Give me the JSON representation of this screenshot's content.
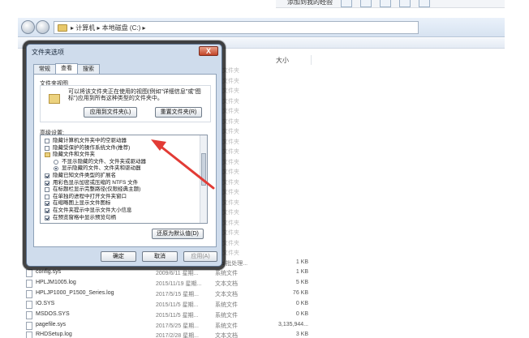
{
  "topbar": {
    "text": "添加到我的经验"
  },
  "address": {
    "path": "▸ 计算机 ▸ 本地磁盘 (C:) ▸"
  },
  "filelist": {
    "size_header": "大小",
    "bg_type_fragments": [
      "文件夹",
      "文件夹",
      "文件夹",
      "文件夹",
      "文件夹",
      "文件夹",
      "文件夹",
      "文件夹",
      "文件夹",
      "文件夹",
      "文件夹",
      "文件夹",
      "文件夹",
      "文件夹",
      "文件夹",
      "文件夹",
      "文件夹",
      "文件夹",
      "文件夹"
    ],
    "rows": [
      {
        "name": "",
        "date": "",
        "type": "dows 批处理...",
        "size": "1 KB"
      },
      {
        "name": "config.sys",
        "date": "2009/6/11 星期...",
        "type": "系统文件",
        "size": "1 KB"
      },
      {
        "name": "HPLJM1005.log",
        "date": "2015/11/19 星期...",
        "type": "文本文档",
        "size": "5 KB"
      },
      {
        "name": "HPLJP1000_P1500_Series.log",
        "date": "2017/5/15 星期...",
        "type": "文本文档",
        "size": "76 KB"
      },
      {
        "name": "IO.SYS",
        "date": "2015/11/5 星期...",
        "type": "系统文件",
        "size": "0 KB"
      },
      {
        "name": "MSDOS.SYS",
        "date": "2015/11/5 星期...",
        "type": "系统文件",
        "size": "0 KB"
      },
      {
        "name": "pagefile.sys",
        "date": "2017/5/25 星期...",
        "type": "系统文件",
        "size": "3,135,944..."
      },
      {
        "name": "RHDSetup.log",
        "date": "2017/2/28 星期...",
        "type": "文本文档",
        "size": "3 KB"
      }
    ]
  },
  "dialog": {
    "title": "文件夹选项",
    "close_label": "X",
    "tabs": [
      {
        "label": "常规"
      },
      {
        "label": "查看"
      },
      {
        "label": "搜索"
      }
    ],
    "folder_view": {
      "label": "文件夹视图",
      "description": "可以将该文件夹正在使用的视图(例如\"详细信息\"或\"图标\")应用到所有这种类型的文件夹中。",
      "apply_button": "应用到文件夹(L)",
      "reset_button": "重置文件夹(R)"
    },
    "advanced": {
      "label": "高级设置:",
      "items": [
        {
          "text": "隐藏计算机文件夹中的空驱动器",
          "control": "checkbox",
          "checked": false,
          "indent": 1
        },
        {
          "text": "隐藏受保护的操作系统文件(推荐)",
          "control": "checkbox",
          "checked": false,
          "indent": 1
        },
        {
          "text": "隐藏文件和文件夹",
          "control": "folder",
          "checked": false,
          "indent": 1
        },
        {
          "text": "不显示隐藏的文件、文件夹或驱动器",
          "control": "radio",
          "checked": false,
          "indent": 2
        },
        {
          "text": "显示隐藏的文件、文件夹和驱动器",
          "control": "radio",
          "checked": true,
          "indent": 2
        },
        {
          "text": "隐藏已知文件类型的扩展名",
          "control": "checkbox",
          "checked": true,
          "indent": 1
        },
        {
          "text": "用彩色显示加密或压缩的 NTFS 文件",
          "control": "checkbox",
          "checked": true,
          "indent": 1
        },
        {
          "text": "在标题栏显示完整路径(仅限经典主题)",
          "control": "checkbox",
          "checked": false,
          "indent": 1
        },
        {
          "text": "在单独的进程中打开文件夹窗口",
          "control": "checkbox",
          "checked": false,
          "indent": 1
        },
        {
          "text": "在缩略图上显示文件图标",
          "control": "checkbox",
          "checked": true,
          "indent": 1
        },
        {
          "text": "在文件夹提示中显示文件大小信息",
          "control": "checkbox",
          "checked": true,
          "indent": 1
        },
        {
          "text": "在预览窗格中显示预览句柄",
          "control": "checkbox",
          "checked": true,
          "indent": 1
        }
      ],
      "restore_button": "还原为默认值(D)"
    },
    "ok_button": "确定",
    "cancel_button": "取消",
    "apply_button": "应用(A)"
  },
  "colors": {
    "arrow": "#e23b35",
    "dialog_frame": "#cfdcec"
  }
}
